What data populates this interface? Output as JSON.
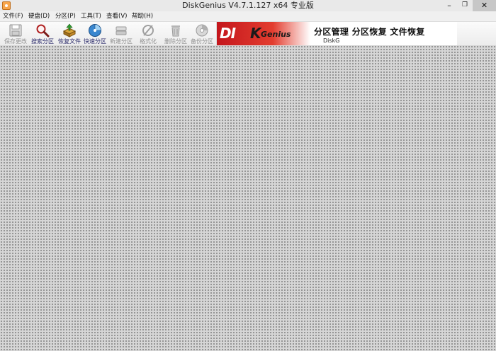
{
  "window": {
    "title": "DiskGenius V4.7.1.127 x64 专业版",
    "minimize_glyph": "–",
    "maximize_glyph": "❐",
    "close_glyph": "✕"
  },
  "menu": {
    "items": [
      {
        "label": "文件(F)"
      },
      {
        "label": "硬盘(D)"
      },
      {
        "label": "分区(P)"
      },
      {
        "label": "工具(T)"
      },
      {
        "label": "查看(V)"
      },
      {
        "label": "帮助(H)"
      }
    ]
  },
  "toolbar": {
    "buttons": [
      {
        "label": "保存更改",
        "icon": "save-icon",
        "enabled": false
      },
      {
        "label": "搜索分区",
        "icon": "search-icon",
        "enabled": true
      },
      {
        "label": "恢复文件",
        "icon": "recover-file-icon",
        "enabled": true
      },
      {
        "label": "快速分区",
        "icon": "quick-partition-icon",
        "enabled": true
      },
      {
        "label": "新建分区",
        "icon": "new-partition-icon",
        "enabled": false
      },
      {
        "label": "格式化",
        "icon": "format-icon",
        "enabled": false
      },
      {
        "label": "删除分区",
        "icon": "delete-icon",
        "enabled": false
      },
      {
        "label": "备份分区",
        "icon": "backup-icon",
        "enabled": false
      }
    ]
  },
  "banner": {
    "logo_left": "DI",
    "logo_k": "K",
    "logo_genius": "Genius",
    "slogan": "分区管理 分区恢复 文件恢复",
    "sub": "DiskG"
  },
  "colors": {
    "brand_red": "#c4161c",
    "toolbar_label": "#2a2a6a",
    "disabled_label": "#909090"
  }
}
